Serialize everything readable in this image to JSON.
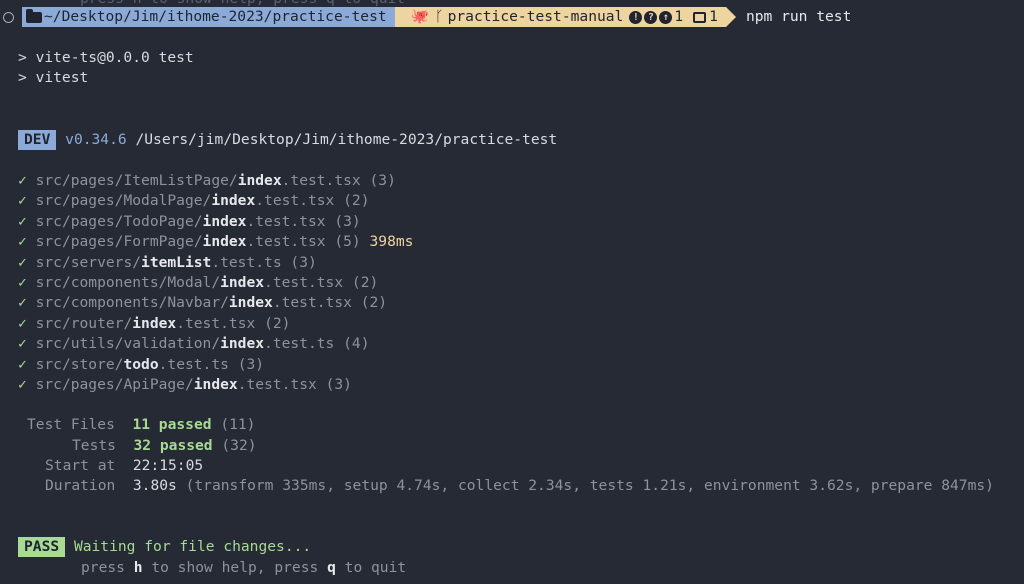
{
  "top_ghost": "press h to show help, press q to quit",
  "prompt": {
    "path": "~/Desktop/Jim/ithome-2023/practice-test",
    "branch": "practice-test-manual",
    "ahead_count": "1",
    "stash_count": "1",
    "command": "npm run test"
  },
  "npm_header": [
    "> vite-ts@0.0.0 test",
    "> vitest"
  ],
  "dev": {
    "badge": "DEV",
    "version": "v0.34.6",
    "path": "/Users/jim/Desktop/Jim/ithome-2023/practice-test"
  },
  "check_mark": "✓",
  "tests": [
    {
      "dir": "src/pages/ItemListPage/",
      "name": "index",
      "ext": ".test.tsx",
      "count": "(3)",
      "time": ""
    },
    {
      "dir": "src/pages/ModalPage/",
      "name": "index",
      "ext": ".test.tsx",
      "count": "(2)",
      "time": ""
    },
    {
      "dir": "src/pages/TodoPage/",
      "name": "index",
      "ext": ".test.tsx",
      "count": "(3)",
      "time": ""
    },
    {
      "dir": "src/pages/FormPage/",
      "name": "index",
      "ext": ".test.tsx",
      "count": "(5)",
      "time": "398"
    },
    {
      "dir": "src/servers/",
      "name": "itemList",
      "ext": ".test.ts",
      "count": "(3)",
      "time": ""
    },
    {
      "dir": "src/components/Modal/",
      "name": "index",
      "ext": ".test.tsx",
      "count": "(2)",
      "time": ""
    },
    {
      "dir": "src/components/Navbar/",
      "name": "index",
      "ext": ".test.tsx",
      "count": "(2)",
      "time": ""
    },
    {
      "dir": "src/router/",
      "name": "index",
      "ext": ".test.tsx",
      "count": "(2)",
      "time": ""
    },
    {
      "dir": "src/utils/validation/",
      "name": "index",
      "ext": ".test.ts",
      "count": "(4)",
      "time": ""
    },
    {
      "dir": "src/store/",
      "name": "todo",
      "ext": ".test.ts",
      "count": "(3)",
      "time": ""
    },
    {
      "dir": "src/pages/ApiPage/",
      "name": "index",
      "ext": ".test.tsx",
      "count": "(3)",
      "time": ""
    }
  ],
  "time_unit": "ms",
  "summary": {
    "test_files_label": "Test Files",
    "test_files_passed": "11 passed",
    "test_files_total": "(11)",
    "tests_label": "Tests",
    "tests_passed": "32 passed",
    "tests_total": "(32)",
    "start_label": "Start at",
    "start_value": "22:15:05",
    "duration_label": "Duration",
    "duration_value": "3.80s",
    "duration_detail": "(transform 335ms, setup 4.74s, collect 2.34s, tests 1.21s, environment 3.62s, prepare 847ms)"
  },
  "pass": {
    "badge": "PASS",
    "message": "Waiting for file changes...",
    "help_press": "press",
    "help_h": "h",
    "help_mid": "to show help, press",
    "help_q": "q",
    "help_end": "to quit"
  }
}
